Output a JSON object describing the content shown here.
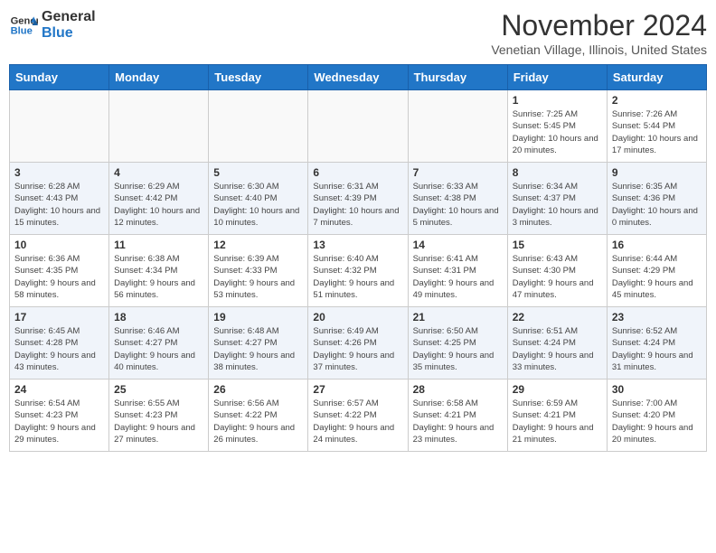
{
  "header": {
    "logo_line1": "General",
    "logo_line2": "Blue",
    "month_title": "November 2024",
    "location": "Venetian Village, Illinois, United States"
  },
  "days_of_week": [
    "Sunday",
    "Monday",
    "Tuesday",
    "Wednesday",
    "Thursday",
    "Friday",
    "Saturday"
  ],
  "weeks": [
    [
      {
        "day": "",
        "info": ""
      },
      {
        "day": "",
        "info": ""
      },
      {
        "day": "",
        "info": ""
      },
      {
        "day": "",
        "info": ""
      },
      {
        "day": "",
        "info": ""
      },
      {
        "day": "1",
        "info": "Sunrise: 7:25 AM\nSunset: 5:45 PM\nDaylight: 10 hours and 20 minutes."
      },
      {
        "day": "2",
        "info": "Sunrise: 7:26 AM\nSunset: 5:44 PM\nDaylight: 10 hours and 17 minutes."
      }
    ],
    [
      {
        "day": "3",
        "info": "Sunrise: 6:28 AM\nSunset: 4:43 PM\nDaylight: 10 hours and 15 minutes."
      },
      {
        "day": "4",
        "info": "Sunrise: 6:29 AM\nSunset: 4:42 PM\nDaylight: 10 hours and 12 minutes."
      },
      {
        "day": "5",
        "info": "Sunrise: 6:30 AM\nSunset: 4:40 PM\nDaylight: 10 hours and 10 minutes."
      },
      {
        "day": "6",
        "info": "Sunrise: 6:31 AM\nSunset: 4:39 PM\nDaylight: 10 hours and 7 minutes."
      },
      {
        "day": "7",
        "info": "Sunrise: 6:33 AM\nSunset: 4:38 PM\nDaylight: 10 hours and 5 minutes."
      },
      {
        "day": "8",
        "info": "Sunrise: 6:34 AM\nSunset: 4:37 PM\nDaylight: 10 hours and 3 minutes."
      },
      {
        "day": "9",
        "info": "Sunrise: 6:35 AM\nSunset: 4:36 PM\nDaylight: 10 hours and 0 minutes."
      }
    ],
    [
      {
        "day": "10",
        "info": "Sunrise: 6:36 AM\nSunset: 4:35 PM\nDaylight: 9 hours and 58 minutes."
      },
      {
        "day": "11",
        "info": "Sunrise: 6:38 AM\nSunset: 4:34 PM\nDaylight: 9 hours and 56 minutes."
      },
      {
        "day": "12",
        "info": "Sunrise: 6:39 AM\nSunset: 4:33 PM\nDaylight: 9 hours and 53 minutes."
      },
      {
        "day": "13",
        "info": "Sunrise: 6:40 AM\nSunset: 4:32 PM\nDaylight: 9 hours and 51 minutes."
      },
      {
        "day": "14",
        "info": "Sunrise: 6:41 AM\nSunset: 4:31 PM\nDaylight: 9 hours and 49 minutes."
      },
      {
        "day": "15",
        "info": "Sunrise: 6:43 AM\nSunset: 4:30 PM\nDaylight: 9 hours and 47 minutes."
      },
      {
        "day": "16",
        "info": "Sunrise: 6:44 AM\nSunset: 4:29 PM\nDaylight: 9 hours and 45 minutes."
      }
    ],
    [
      {
        "day": "17",
        "info": "Sunrise: 6:45 AM\nSunset: 4:28 PM\nDaylight: 9 hours and 43 minutes."
      },
      {
        "day": "18",
        "info": "Sunrise: 6:46 AM\nSunset: 4:27 PM\nDaylight: 9 hours and 40 minutes."
      },
      {
        "day": "19",
        "info": "Sunrise: 6:48 AM\nSunset: 4:27 PM\nDaylight: 9 hours and 38 minutes."
      },
      {
        "day": "20",
        "info": "Sunrise: 6:49 AM\nSunset: 4:26 PM\nDaylight: 9 hours and 37 minutes."
      },
      {
        "day": "21",
        "info": "Sunrise: 6:50 AM\nSunset: 4:25 PM\nDaylight: 9 hours and 35 minutes."
      },
      {
        "day": "22",
        "info": "Sunrise: 6:51 AM\nSunset: 4:24 PM\nDaylight: 9 hours and 33 minutes."
      },
      {
        "day": "23",
        "info": "Sunrise: 6:52 AM\nSunset: 4:24 PM\nDaylight: 9 hours and 31 minutes."
      }
    ],
    [
      {
        "day": "24",
        "info": "Sunrise: 6:54 AM\nSunset: 4:23 PM\nDaylight: 9 hours and 29 minutes."
      },
      {
        "day": "25",
        "info": "Sunrise: 6:55 AM\nSunset: 4:23 PM\nDaylight: 9 hours and 27 minutes."
      },
      {
        "day": "26",
        "info": "Sunrise: 6:56 AM\nSunset: 4:22 PM\nDaylight: 9 hours and 26 minutes."
      },
      {
        "day": "27",
        "info": "Sunrise: 6:57 AM\nSunset: 4:22 PM\nDaylight: 9 hours and 24 minutes."
      },
      {
        "day": "28",
        "info": "Sunrise: 6:58 AM\nSunset: 4:21 PM\nDaylight: 9 hours and 23 minutes."
      },
      {
        "day": "29",
        "info": "Sunrise: 6:59 AM\nSunset: 4:21 PM\nDaylight: 9 hours and 21 minutes."
      },
      {
        "day": "30",
        "info": "Sunrise: 7:00 AM\nSunset: 4:20 PM\nDaylight: 9 hours and 20 minutes."
      }
    ]
  ]
}
